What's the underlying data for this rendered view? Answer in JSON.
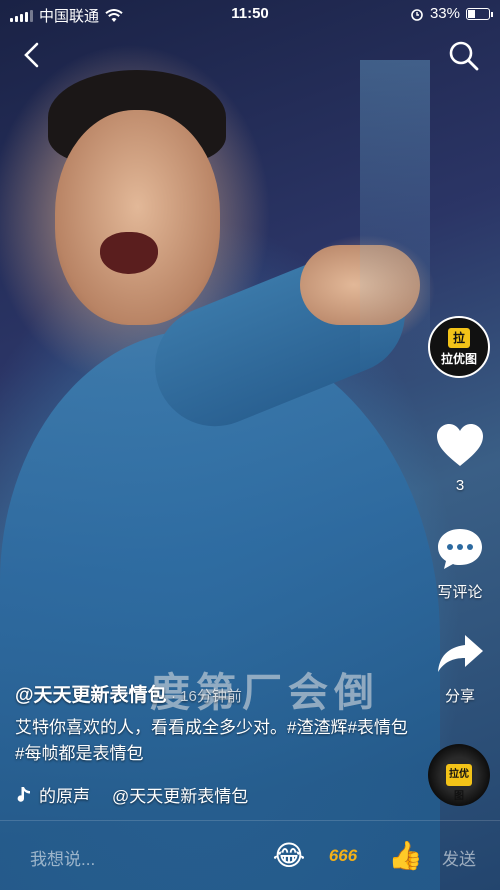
{
  "status_bar": {
    "carrier": "中国联通",
    "time": "11:50",
    "battery": "33%",
    "icons": [
      "signal-icon",
      "wifi-icon",
      "alarm-icon",
      "battery-icon"
    ]
  },
  "nav": {
    "back_icon": "chevron-left-icon",
    "search_icon": "search-icon"
  },
  "video": {
    "watermark_text": "度第厂会倒"
  },
  "rail": {
    "creator_avatar_badge": "拉",
    "creator_avatar_name": "拉优图",
    "like_count": "3",
    "comment_label": "写评论",
    "share_label": "分享",
    "music_disc_badge": "拉优图"
  },
  "caption": {
    "author": "@天天更新表情包",
    "time": "· 16分钟前",
    "text": "艾特你喜欢的人，看看成全多少对。#渣渣辉#表情包#每帧都是表情包"
  },
  "music": {
    "label": "的原声",
    "author": "@天天更新表情包"
  },
  "comment_bar": {
    "placeholder": "我想说...",
    "emoji_1": "😂",
    "emoji_2": "666",
    "emoji_3": "👍",
    "send_label": "发送"
  },
  "colors": {
    "accent_yellow": "#f3c318",
    "like_heart": "#ffffff"
  }
}
